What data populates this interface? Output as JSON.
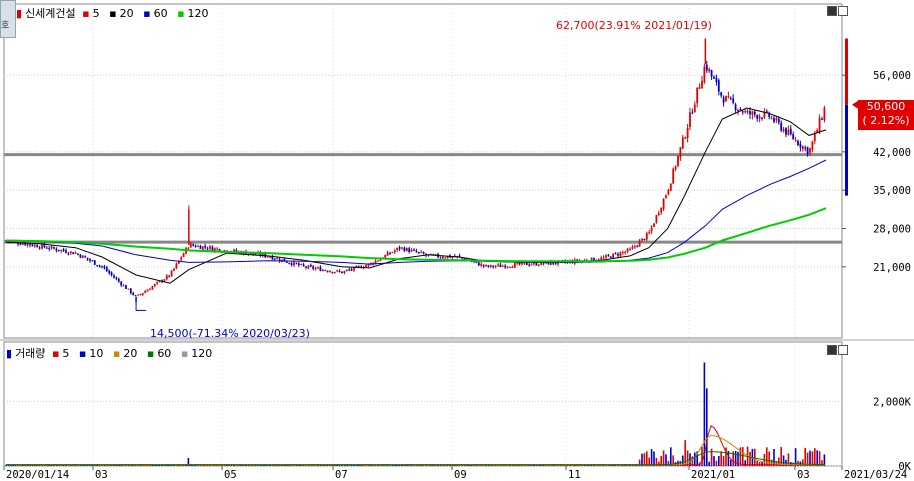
{
  "price_panel": {
    "stock_name": "신세계건설",
    "ma_legend": [
      {
        "label": "5",
        "color": "#e00000"
      },
      {
        "label": "20",
        "color": "#000000"
      },
      {
        "label": "60",
        "color": "#0000cc"
      },
      {
        "label": "120",
        "color": "#00cc00"
      }
    ],
    "high_annotation": "62,700(23.91% 2021/01/19)",
    "low_annotation": "14,500(-71.34% 2020/03/23)",
    "current_price": "50,600",
    "current_change": "( 2.12%)",
    "side_tab": "호"
  },
  "volume_panel": {
    "title": "거래량",
    "ma_legend": [
      {
        "label": "5",
        "color": "#e00000"
      },
      {
        "label": "10",
        "color": "#0000cc"
      },
      {
        "label": "20",
        "color": "#cc8800"
      },
      {
        "label": "60",
        "color": "#007700"
      },
      {
        "label": "120",
        "color": "#999999"
      }
    ]
  },
  "chart_data": {
    "type": "candlestick",
    "price_axis": {
      "ticks": [
        "56,000",
        "42,000",
        "35,000",
        "28,000",
        "21,000"
      ],
      "values": [
        56000,
        42000,
        35000,
        28000,
        21000
      ],
      "ylim": [
        8000,
        69000
      ]
    },
    "volume_axis": {
      "ticks": [
        "2,000K",
        "0K"
      ],
      "values": [
        2000,
        0
      ],
      "ylim": [
        0,
        3400
      ]
    },
    "x_ticks": [
      "2020/01/14",
      "03",
      "05",
      "07",
      "09",
      "11",
      "2021/01",
      "03",
      "2021/03/24"
    ],
    "horizontal_lines": [
      41500,
      25500
    ],
    "price_series": [
      {
        "date": "2020/01/14",
        "close": 25800
      },
      {
        "date": "2020/02/01",
        "close": 24800
      },
      {
        "date": "2020/02/20",
        "close": 23500
      },
      {
        "date": "2020/03/05",
        "close": 21000
      },
      {
        "date": "2020/03/23",
        "close": 15500,
        "low": 14500
      },
      {
        "date": "2020/04/10",
        "close": 19500
      },
      {
        "date": "2020/04/20",
        "close": 25000,
        "high": 31500
      },
      {
        "date": "2020/05/10",
        "close": 24000
      },
      {
        "date": "2020/06/01",
        "close": 23000
      },
      {
        "date": "2020/06/20",
        "close": 21000
      },
      {
        "date": "2020/07/10",
        "close": 20000
      },
      {
        "date": "2020/07/25",
        "close": 21500
      },
      {
        "date": "2020/08/10",
        "close": 24500
      },
      {
        "date": "2020/08/25",
        "close": 23000
      },
      {
        "date": "2020/09/10",
        "close": 22800
      },
      {
        "date": "2020/09/25",
        "close": 21000
      },
      {
        "date": "2020/10/15",
        "close": 21500
      },
      {
        "date": "2020/11/05",
        "close": 21800
      },
      {
        "date": "2020/11/25",
        "close": 22500
      },
      {
        "date": "2020/12/10",
        "close": 24000
      },
      {
        "date": "2020/12/20",
        "close": 27000
      },
      {
        "date": "2020/12/30",
        "close": 35000
      },
      {
        "date": "2021/01/08",
        "close": 45000
      },
      {
        "date": "2021/01/19",
        "close": 58000,
        "high": 62700
      },
      {
        "date": "2021/01/28",
        "close": 52000
      },
      {
        "date": "2021/02/10",
        "close": 49000
      },
      {
        "date": "2021/02/22",
        "close": 48500
      },
      {
        "date": "2021/03/05",
        "close": 45000
      },
      {
        "date": "2021/03/15",
        "close": 42000
      },
      {
        "date": "2021/03/24",
        "close": 50600
      }
    ],
    "ma_series": [
      {
        "name": "20",
        "values": [
          25500,
          25200,
          24500,
          22800,
          19500,
          18000,
          20500,
          23500,
          23000,
          22200,
          21000,
          20800,
          22500,
          23200,
          22800,
          22000,
          21800,
          21800,
          22200,
          23000,
          24500,
          28000,
          34000,
          42000,
          48000,
          50000,
          49000,
          47500,
          45000,
          46000
        ]
      },
      {
        "name": "60",
        "values": [
          25800,
          25600,
          25300,
          24800,
          23200,
          22200,
          21800,
          21900,
          22100,
          22000,
          21800,
          21500,
          21800,
          22000,
          22100,
          22000,
          21900,
          21800,
          21900,
          22200,
          22600,
          23600,
          25500,
          28500,
          31500,
          34000,
          36000,
          37500,
          39000,
          40500
        ]
      },
      {
        "name": "120",
        "values": [
          25800,
          25700,
          25500,
          25200,
          24700,
          24300,
          24000,
          23700,
          23500,
          23200,
          22900,
          22600,
          22400,
          22300,
          22200,
          22100,
          22000,
          22000,
          22000,
          22100,
          22300,
          22700,
          23400,
          24500,
          25800,
          27200,
          28500,
          29500,
          30500,
          31700
        ]
      }
    ],
    "volume_series": [
      {
        "date": "2020/04/20",
        "volume": 250
      },
      {
        "date": "2021/01/08",
        "volume": 800
      },
      {
        "date": "2021/01/19",
        "volume": 3200
      },
      {
        "date": "2021/01/20",
        "volume": 2400
      },
      {
        "date": "2021/02/10",
        "volume": 600
      }
    ],
    "volume_ma": [
      {
        "name": "5",
        "peak": 1200
      },
      {
        "name": "20",
        "peak": 900
      },
      {
        "name": "60",
        "peak": 400
      }
    ]
  }
}
